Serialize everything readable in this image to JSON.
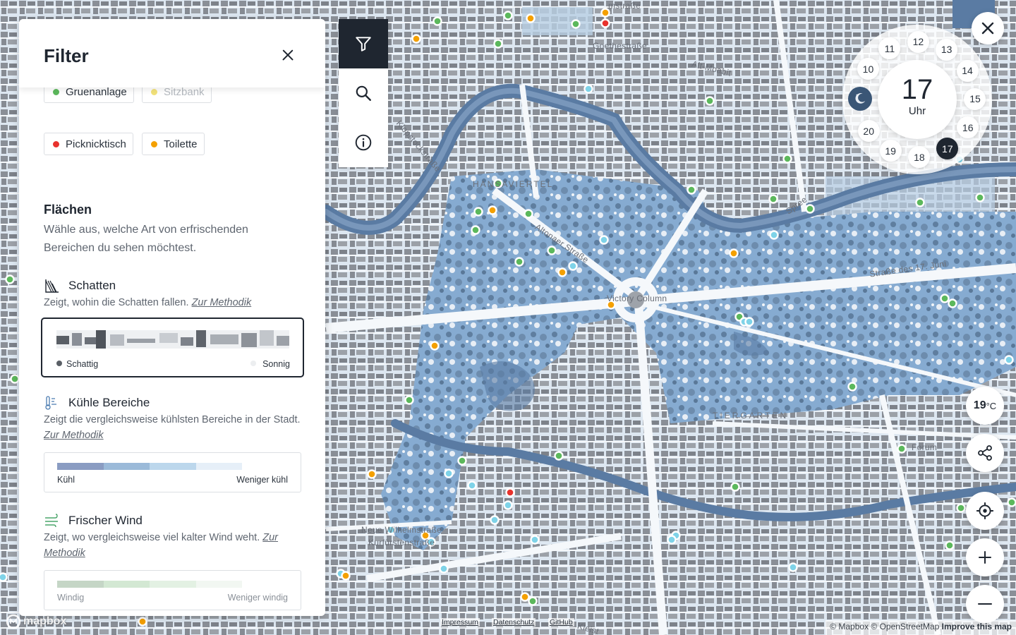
{
  "panel": {
    "title": "Filter",
    "chips": [
      {
        "label": "Gruenanlage",
        "color": "#5cb85c",
        "state": "on"
      },
      {
        "label": "Sitzbank",
        "color": "#f2e27a",
        "state": "off"
      },
      {
        "label": "Picknicktisch",
        "color": "#e8322d",
        "state": "on"
      },
      {
        "label": "Toilette",
        "color": "#f4a000",
        "state": "on"
      }
    ],
    "areas_title": "Flächen",
    "areas_desc": "Wähle aus, welche Art von erfrischenden Bereichen du sehen möchtest.",
    "layers": [
      {
        "name": "Schatten",
        "desc": "Zeigt, wohin die Schatten fallen.",
        "link": "Zur Methodik",
        "legend_left": "Schattig",
        "legend_right": "Sonnig",
        "selected": true
      },
      {
        "name": "Kühle Bereiche",
        "desc": "Zeigt die vergleichsweise kühlsten Bereiche in der Stadt.",
        "link": "Zur Methodik",
        "legend_left": "Kühl",
        "legend_right": "Weniger kühl",
        "scale": [
          "#8a9cc2",
          "#9bbad9",
          "#bcd7ec",
          "#e6eff8"
        ]
      },
      {
        "name": "Frischer Wind",
        "desc": "Zeigt, wo vergleichsweise viel kalter Wind weht.",
        "link": "Zur Methodik",
        "legend_left": "Windig",
        "legend_right": "Weniger windig",
        "scale": [
          "#c5d6c6",
          "#d3e8d3",
          "#e3f1e3",
          "#f2f7f2"
        ]
      }
    ]
  },
  "tools": [
    {
      "icon": "filter-icon",
      "active": true
    },
    {
      "icon": "search-icon",
      "active": false
    },
    {
      "icon": "info-icon",
      "active": false
    }
  ],
  "time_dial": {
    "current_hour": "17",
    "unit": "Uhr",
    "hours": [
      "10",
      "11",
      "12",
      "13",
      "14",
      "15",
      "16",
      "17",
      "18",
      "19",
      "20"
    ],
    "selected_hour": "17"
  },
  "temperature": {
    "value": "19",
    "unit": "°C"
  },
  "map_labels": {
    "victory_column": "Victory Column",
    "strasse_17_juni": "Straße des 17. Juni",
    "alt_moabit": "Alt-Moabit",
    "altonaer_strasse": "Altonaer Straße",
    "spree": "Spree",
    "tiergarten": "TIERGARTEN",
    "forum": "Forum",
    "neue_wilhelmstrasse": "Neue Wilhelmstraße",
    "kurfuerstenstrasse": "Kurfürstenstraße",
    "hansaviertel": "HANSAVIERTEL",
    "strasse_top": "mstraße",
    "goethe": "Goethestraße",
    "klopstock": "Klopstockstraße",
    "kleist": "Kleist"
  },
  "footer": {
    "links": [
      "Impressum",
      "Datenschutz",
      "GitHub"
    ],
    "attribution": "© Mapbox © OpenStreetMap",
    "improve": "Improve this map",
    "logo": "mapbox"
  },
  "colors": {
    "dark": "#1f2630",
    "water": "#5a7ba3",
    "park": "#7fa5cc",
    "block": "#c9d8e6",
    "building": "#8a8f97"
  }
}
